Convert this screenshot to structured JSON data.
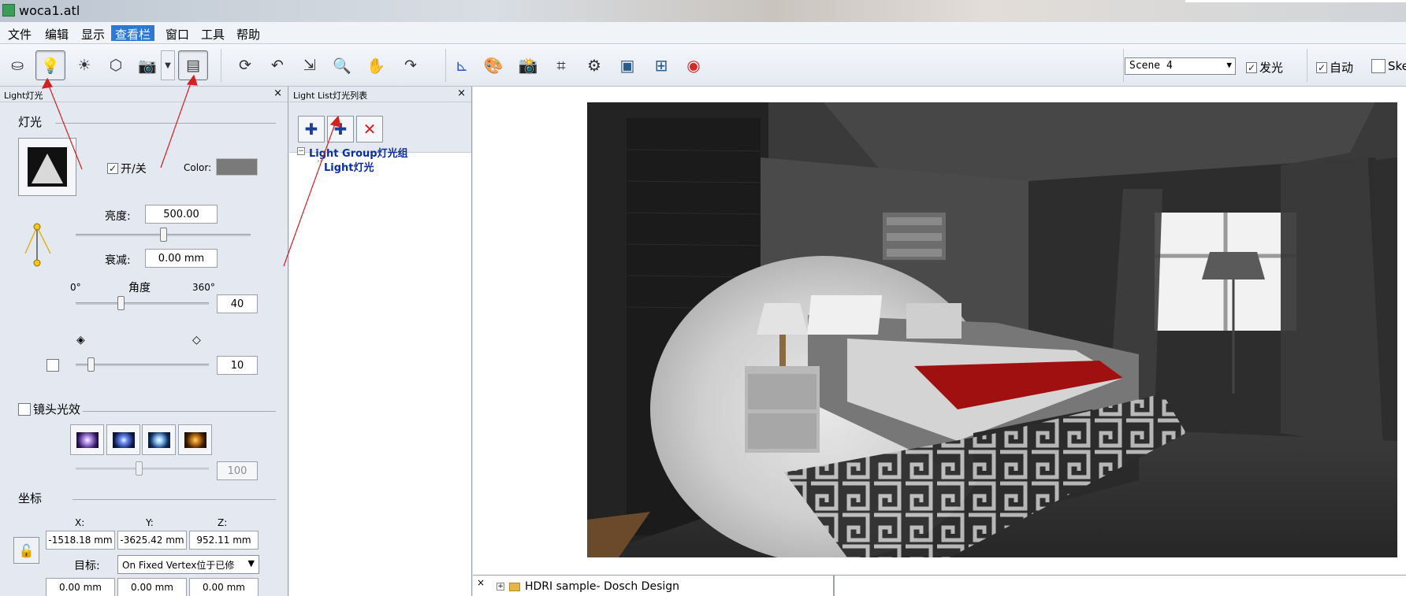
{
  "window": {
    "title": "woca1.atl"
  },
  "menu": [
    "文件",
    "编辑",
    "显示",
    "查看栏",
    "窗口",
    "工具",
    "帮助"
  ],
  "menu_active_index": 3,
  "toolbar": {
    "scene_select": "Scene 4",
    "check_glow": {
      "label": "发光",
      "checked": true
    },
    "check_auto": {
      "label": "自动",
      "checked": true
    },
    "check_skel": {
      "label": "Ske",
      "checked": false
    }
  },
  "light_panel": {
    "header": "Light灯光",
    "section_light": "灯光",
    "onoff_label": "开/关",
    "onoff_checked": true,
    "color_label": "Color:",
    "color_value": "#7a7a7a",
    "brightness_label": "亮度:",
    "brightness_value": "500.00",
    "brightness_level": 0.5,
    "falloff_label": "衰减:",
    "falloff_value": "0.00 mm",
    "angle_min": "0°",
    "angle_label": "角度",
    "angle_max": "360°",
    "angle_value": "40",
    "softness_value": "10",
    "lens_flare_label": "镜头光效",
    "lens_flare_value": "100",
    "section_coords": "坐标",
    "x_label": "X:",
    "y_label": "Y:",
    "z_label": "Z:",
    "x_value": "-1518.18 mm",
    "y_value": "-3625.42 mm",
    "z_value": "952.11 mm",
    "target_label": "目标:",
    "target_value": "On Fixed Vertex位于已修",
    "tx_value": "0.00 mm",
    "ty_value": "0.00 mm",
    "tz_value": "0.00 mm"
  },
  "light_list_panel": {
    "header": "Light List灯光列表",
    "tree": [
      {
        "label": "Light Group灯光组",
        "expander": "−"
      },
      {
        "label": "Light灯光"
      }
    ]
  },
  "bottom_panel": {
    "item": "HDRI sample- Dosch Design"
  }
}
